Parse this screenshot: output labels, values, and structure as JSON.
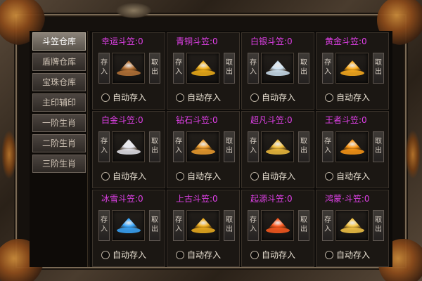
{
  "tabs": [
    {
      "label": "斗笠仓库",
      "active": true
    },
    {
      "label": "盾牌仓库",
      "active": false
    },
    {
      "label": "宝珠仓库",
      "active": false
    },
    {
      "label": "主印辅印",
      "active": false
    },
    {
      "label": "一阶生肖",
      "active": false
    },
    {
      "label": "二阶生肖",
      "active": false
    },
    {
      "label": "三阶生肖",
      "active": false
    }
  ],
  "cells": [
    {
      "title": "幸运斗笠:0",
      "store": "存入",
      "take": "取出",
      "auto": "自动存入",
      "icon": "lucky-hat-icon",
      "color": "#b8763a"
    },
    {
      "title": "青铜斗笠:0",
      "store": "存入",
      "take": "取出",
      "auto": "自动存入",
      "icon": "bronze-hat-icon",
      "color": "#f2b21a"
    },
    {
      "title": "白银斗笠:0",
      "store": "存入",
      "take": "取出",
      "auto": "自动存入",
      "icon": "silver-hat-icon",
      "color": "#cfe4f4"
    },
    {
      "title": "黄金斗笠:0",
      "store": "存入",
      "take": "取出",
      "auto": "自动存入",
      "icon": "gold-hat-icon",
      "color": "#ffb020"
    },
    {
      "title": "白金斗笠:0",
      "store": "存入",
      "take": "取出",
      "auto": "自动存入",
      "icon": "platinum-hat-icon",
      "color": "#e8e8f0"
    },
    {
      "title": "钻石斗笠:0",
      "store": "存入",
      "take": "取出",
      "auto": "自动存入",
      "icon": "diamond-hat-icon",
      "color": "#f0a030"
    },
    {
      "title": "超凡斗笠:0",
      "store": "存入",
      "take": "取出",
      "auto": "自动存入",
      "icon": "transcendent-hat-icon",
      "color": "#f2c040"
    },
    {
      "title": "王者斗笠:0",
      "store": "存入",
      "take": "取出",
      "auto": "自动存入",
      "icon": "king-hat-icon",
      "color": "#ff9a18"
    },
    {
      "title": "冰雪斗笠:0",
      "store": "存入",
      "take": "取出",
      "auto": "自动存入",
      "icon": "ice-hat-icon",
      "color": "#3aa8ff"
    },
    {
      "title": "上古斗笠:0",
      "store": "存入",
      "take": "取出",
      "auto": "自动存入",
      "icon": "ancient-hat-icon",
      "color": "#f0b020"
    },
    {
      "title": "起源斗笠:0",
      "store": "存入",
      "take": "取出",
      "auto": "自动存入",
      "icon": "origin-hat-icon",
      "color": "#ff5a20"
    },
    {
      "title": "鸿蒙·斗笠:0",
      "store": "存入",
      "take": "取出",
      "auto": "自动存入",
      "icon": "chaos-hat-icon",
      "color": "#f8c848"
    }
  ]
}
